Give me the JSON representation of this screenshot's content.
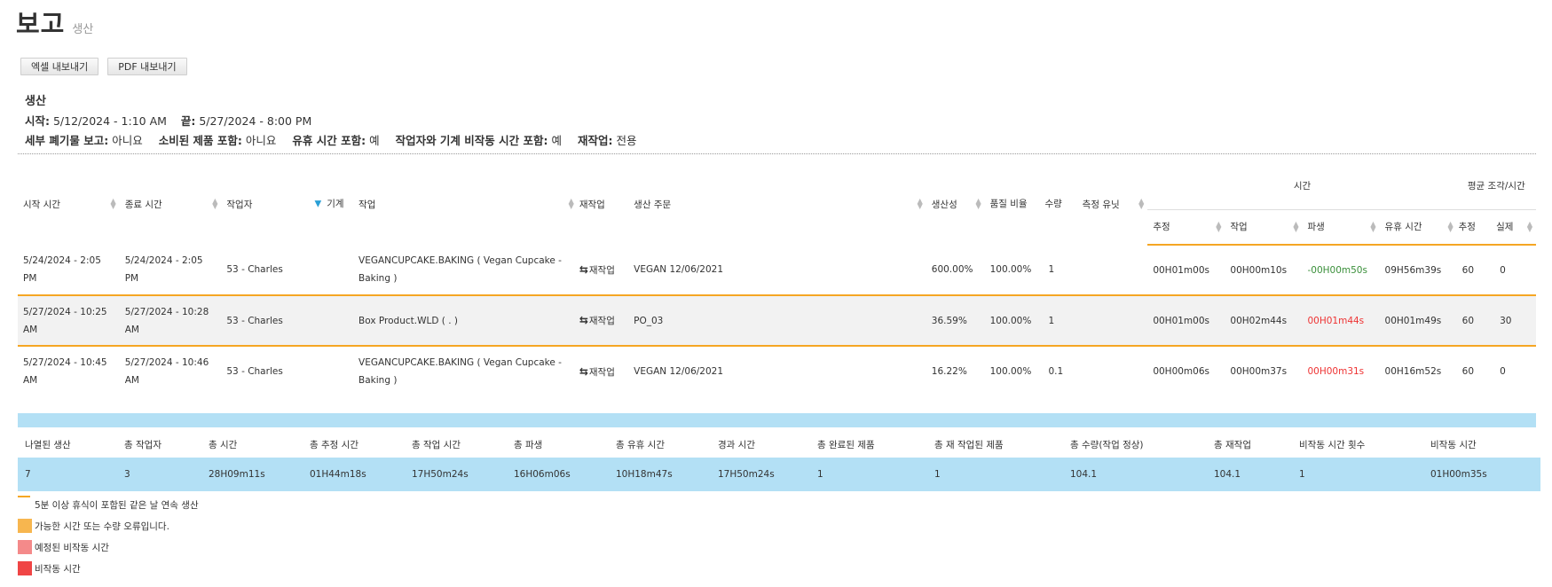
{
  "header": {
    "title": "보고",
    "subtitle": "생산"
  },
  "export": {
    "excel_label": "엑셀 내보내기",
    "pdf_label": "PDF 내보내기"
  },
  "info": {
    "section": "생산",
    "start_label": "시작:",
    "start_value": "5/12/2024 - 1:10 AM",
    "end_label": "끝:",
    "end_value": "5/27/2024 - 8:00 PM",
    "scrap_label": "세부 폐기물 보고:",
    "scrap_value": "아니요",
    "consumed_label": "소비된 제품 포함:",
    "consumed_value": "아니요",
    "idle_label": "유휴 시간 포함:",
    "idle_value": "예",
    "downtime_label": "작업자와 기계 비작동 시간 포함:",
    "downtime_value": "예",
    "rework_label": "재작업:",
    "rework_value": "전용"
  },
  "table": {
    "headers": {
      "start": "시작 시간",
      "end": "종료 시간",
      "operator": "작업자",
      "machine": "기계",
      "task": "작업",
      "rework": "재작업",
      "order": "생산 주문",
      "productivity": "생산성",
      "quality": "품질 비율",
      "qty": "수량",
      "unit": "측정 유닛",
      "time_group": "시간",
      "avg_group": "평균 조각/시간",
      "estimated": "추정",
      "worked": "작업",
      "variance": "파생",
      "idle": "유휴 시간",
      "avg_est": "추정",
      "avg_actual": "실제"
    },
    "rows": [
      {
        "start": "5/24/2024 - 2:05 PM",
        "end": "5/24/2024 - 2:05 PM",
        "operator": "53 - Charles",
        "machine": "",
        "task": "VEGANCUPCAKE.BAKING ( Vegan Cupcake - Baking )",
        "rework": "재작업",
        "order": "VEGAN 12/06/2021",
        "productivity": "600.00%",
        "quality": "100.00%",
        "qty": "1",
        "unit": "",
        "estimated": "00H01m00s",
        "worked": "00H00m10s",
        "variance": "-00H00m50s",
        "idle": "09H56m39s",
        "avg_est": "60",
        "avg_actual": "0"
      },
      {
        "start": "5/27/2024 - 10:25 AM",
        "end": "5/27/2024 - 10:28 AM",
        "operator": "53 - Charles",
        "machine": "",
        "task": "Box Product.WLD ( . )",
        "rework": "재작업",
        "order": "PO_03",
        "productivity": "36.59%",
        "quality": "100.00%",
        "qty": "1",
        "unit": "",
        "estimated": "00H01m00s",
        "worked": "00H02m44s",
        "variance": "00H01m44s",
        "idle": "00H01m49s",
        "avg_est": "60",
        "avg_actual": "30"
      },
      {
        "start": "5/27/2024 - 10:45 AM",
        "end": "5/27/2024 - 10:46 AM",
        "operator": "53 - Charles",
        "machine": "",
        "task": "VEGANCUPCAKE.BAKING ( Vegan Cupcake - Baking )",
        "rework": "재작업",
        "order": "VEGAN 12/06/2021",
        "productivity": "16.22%",
        "quality": "100.00%",
        "qty": "0.1",
        "unit": "",
        "estimated": "00H00m06s",
        "worked": "00H00m37s",
        "variance": "00H00m31s",
        "idle": "00H16m52s",
        "avg_est": "60",
        "avg_actual": "0"
      }
    ]
  },
  "summary": {
    "headers": [
      "나열된 생산",
      "총 작업자",
      "총 시간",
      "총 추정 시간",
      "총 작업 시간",
      "총 파생",
      "총 유휴 시간",
      "경과 시간",
      "총 완료된 제품",
      "총 재 작업된 제품",
      "총 수량(작업 정상)",
      "총 재작업",
      "비작동 시간 횟수",
      "비작동 시간"
    ],
    "values": [
      "7",
      "3",
      "28H09m11s",
      "01H44m18s",
      "17H50m24s",
      "16H06m06s",
      "10H18m47s",
      "17H50m24s",
      "1",
      "1",
      "104.1",
      "104.1",
      "1",
      "01H00m35s"
    ]
  },
  "legend": {
    "items": [
      {
        "label": "5분 이상 휴식이 포함된 같은 날 연속 생산",
        "color": "#f5a623"
      },
      {
        "label": "가능한 시간 또는 수량 오류입니다.",
        "color": "#f7b64f"
      },
      {
        "label": "예정된 비작동 시간",
        "color": "#f48a8a"
      },
      {
        "label": "비작동 시간",
        "color": "#f04545"
      }
    ]
  },
  "colors": {
    "accent_line": "#f5a623",
    "summary_bg": "#b3e0f5",
    "negative": "#3a8f3a",
    "positive_variance": "#ee3333"
  }
}
